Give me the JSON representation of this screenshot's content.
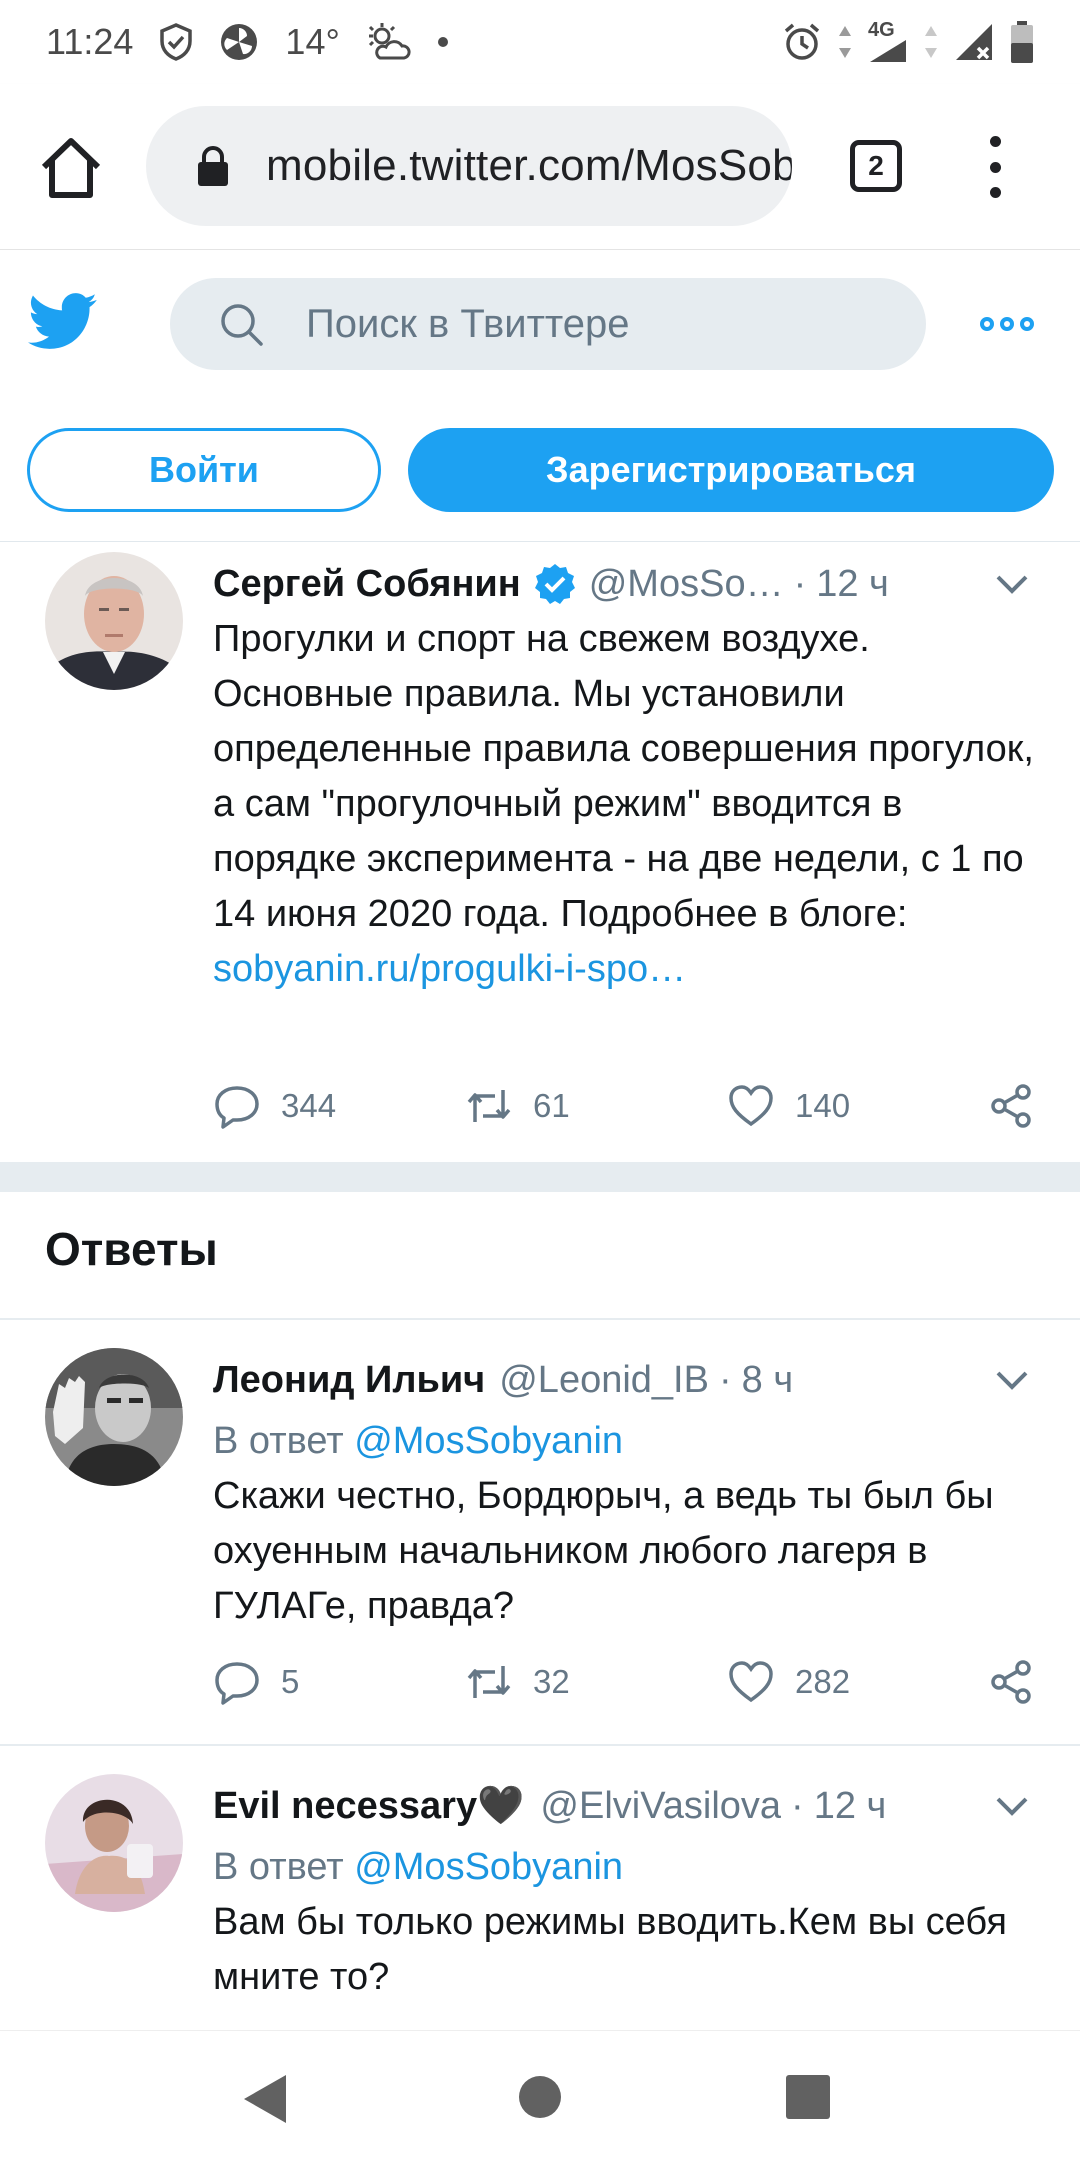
{
  "status_bar": {
    "time": "11:24",
    "temperature": "14°",
    "network": "4G"
  },
  "browser": {
    "url": "mobile.twitter.com/MosSobyanin",
    "tab_count": "2"
  },
  "twitter": {
    "search_placeholder": "Поиск в Твиттере",
    "login_label": "Войти",
    "signup_label": "Зарегистрироваться",
    "brand_color": "#1da1f2"
  },
  "main_tweet": {
    "name": "Сергей Собянин",
    "handle": "@MosSo…",
    "separator": "·",
    "time": "12 ч",
    "text": "Прогулки и спорт на свежем воздухе. Основные правила. Мы установили определенные правила совершения прогулок, а сам \"прогулочный режим\" вводится в порядке эксперимента - на две недели, с 1 по 14 июня 2020 года. Подробнее в блоге: ",
    "link": "sobyanin.ru/progulki-i-spo…",
    "replies": "344",
    "retweets": "61",
    "likes": "140"
  },
  "replies_title": "Ответы",
  "replies": [
    {
      "name": "Леонид Ильич",
      "handle": "@Leonid_IB",
      "separator": "·",
      "time": "8 ч",
      "reply_prefix": "В ответ ",
      "reply_to": "@MosSobyanin",
      "text": "Скажи честно, Бордюрыч, а ведь ты был бы охуенным начальником любого лагеря в ГУЛАГе, правда?",
      "replies": "5",
      "retweets": "32",
      "likes": "282"
    },
    {
      "name": "Evil necessary",
      "name_emoji": "🖤",
      "handle": "@ElviVasilova",
      "separator": "·",
      "time": "12 ч",
      "reply_prefix": "В ответ ",
      "reply_to": "@MosSobyanin",
      "text": "Вам бы только режимы вводить.Кем вы себя мните то?"
    }
  ]
}
